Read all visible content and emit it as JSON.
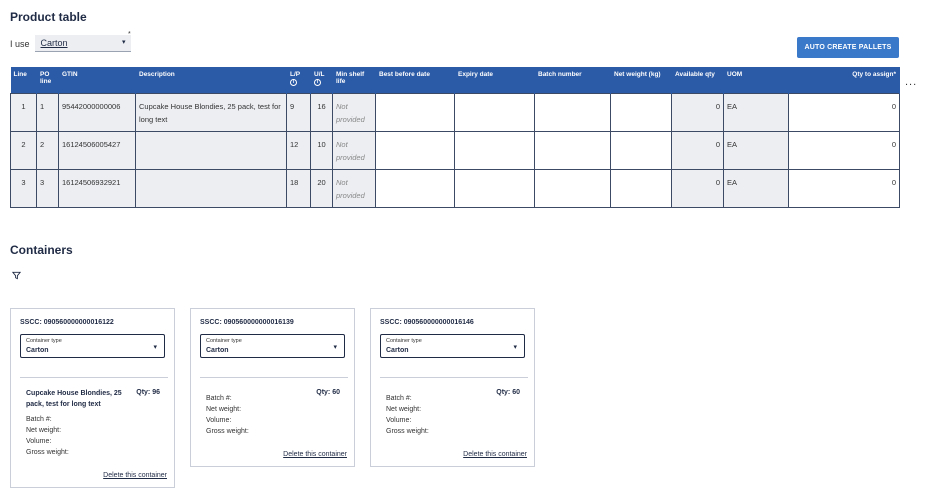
{
  "product_table": {
    "title": "Product table",
    "i_use_label": "I use",
    "i_use_value": "Carton",
    "required_mark": "*",
    "auto_create_label": "AUTO CREATE PALLETS",
    "more_label": "...",
    "columns": {
      "line": "Line",
      "po_line_1": "PO",
      "po_line_2": "line",
      "gtin": "GTIN",
      "description": "Description",
      "lp": "L/P",
      "ul": "U/L",
      "info_icon": "i",
      "min_shelf_1": "Min shelf",
      "min_shelf_2": "life",
      "best_before": "Best before date",
      "expiry": "Expiry date",
      "batch": "Batch number",
      "net_weight": "Net weight (kg)",
      "available_qty": "Available qty",
      "uom": "UOM",
      "qty_to_assign": "Qty to assign*"
    },
    "rows": [
      {
        "line": "1",
        "po_line": "1",
        "gtin": "95442000000006",
        "description": "Cupcake House Blondies, 25 pack, test for long text",
        "lp": "9",
        "ul": "16",
        "min_shelf_1": "Not",
        "min_shelf_2": "provided",
        "best_before": "",
        "expiry": "",
        "batch": "",
        "net_weight": "",
        "available_qty": "0",
        "uom": "EA",
        "qty_to_assign": "0"
      },
      {
        "line": "2",
        "po_line": "2",
        "gtin": "16124506005427",
        "description": "",
        "lp": "12",
        "ul": "10",
        "min_shelf_1": "Not",
        "min_shelf_2": "provided",
        "best_before": "",
        "expiry": "",
        "batch": "",
        "net_weight": "",
        "available_qty": "0",
        "uom": "EA",
        "qty_to_assign": "0"
      },
      {
        "line": "3",
        "po_line": "3",
        "gtin": "16124506932921",
        "description": "",
        "lp": "18",
        "ul": "20",
        "min_shelf_1": "Not",
        "min_shelf_2": "provided",
        "best_before": "",
        "expiry": "",
        "batch": "",
        "net_weight": "",
        "available_qty": "0",
        "uom": "EA",
        "qty_to_assign": "0"
      }
    ]
  },
  "containers": {
    "title": "Containers",
    "filter_icon": "filter-icon",
    "cards": [
      {
        "sscc": "SSCC: 090560000000016122",
        "type_label": "Container type",
        "type_value": "Carton",
        "product": "Cupcake House Blondies, 25 pack, test for long text",
        "qty": "Qty: 96",
        "batch": "Batch #:",
        "net_weight": "Net weight:",
        "volume": "Volume:",
        "gross_weight": "Gross weight:",
        "delete_label": "Delete this container"
      },
      {
        "sscc": "SSCC: 090560000000016139",
        "type_label": "Container type",
        "type_value": "Carton",
        "product": "",
        "qty": "Qty: 60",
        "batch": "Batch #:",
        "net_weight": "Net weight:",
        "volume": "Volume:",
        "gross_weight": "Gross weight:",
        "delete_label": "Delete this container"
      },
      {
        "sscc": "SSCC: 090560000000016146",
        "type_label": "Container type",
        "type_value": "Carton",
        "product": "",
        "qty": "Qty: 60",
        "batch": "Batch #:",
        "net_weight": "Net weight:",
        "volume": "Volume:",
        "gross_weight": "Gross weight:",
        "delete_label": "Delete this container"
      }
    ]
  },
  "colors": {
    "header_blue": "#2b5aa6",
    "button_blue": "#3a78c9",
    "grey_cell": "#eceef2",
    "text_dark": "#1f2a44"
  }
}
